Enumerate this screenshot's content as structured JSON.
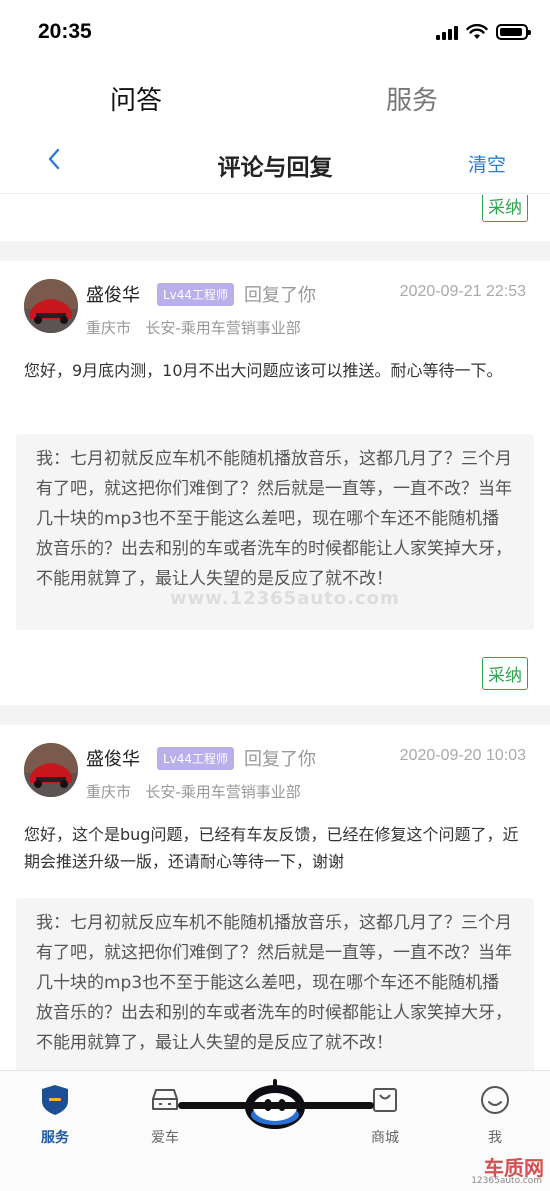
{
  "status_bar": {
    "time": "20:35",
    "battery_level": 0.9
  },
  "top_tabs": [
    {
      "label": "问答",
      "active": true
    },
    {
      "label": "服务",
      "active": false
    }
  ],
  "nav": {
    "title": "评论与回复",
    "clear_label": "清空",
    "back_icon": "chevron-left-icon"
  },
  "feed": {
    "partial_adopt_label": "采纳",
    "items": [
      {
        "username": "盛俊华",
        "level": "Lv44工程师",
        "action": "回复了你",
        "timestamp": "2020-09-21 22:53",
        "city": "重庆市",
        "org": "长安-乘用车营销事业部",
        "reply": "您好，9月底内测，10月不出大问题应该可以推送。耐心等待一下。",
        "quote": "我：七月初就反应车机不能随机播放音乐，这都几月了？三个月有了吧，就这把你们难倒了？然后就是一直等，一直不改？当年几十块的mp3也不至于能这么差吧，现在哪个车还不能随机播放音乐的？出去和别的车或者洗车的时候都能让人家笑掉大牙，不能用就算了，最让人失望的是反应了就不改！",
        "adopt_label": "采纳"
      },
      {
        "username": "盛俊华",
        "level": "Lv44工程师",
        "action": "回复了你",
        "timestamp": "2020-09-20 10:03",
        "city": "重庆市",
        "org": "长安-乘用车营销事业部",
        "reply": "您好，这个是bug问题，已经有车友反馈，已经在修复这个问题了，近期会推送升级一版，还请耐心等待一下，谢谢",
        "quote": "我：七月初就反应车机不能随机播放音乐，这都几月了？三个月有了吧，就这把你们难倒了？然后就是一直等，一直不改？当年几十块的mp3也不至于能这么差吧，现在哪个车还不能随机播放音乐的？出去和别的车或者洗车的时候都能让人家笑掉大牙，不能用就算了，最让人失望的是反应了就不改！"
      }
    ]
  },
  "watermark": {
    "middle": "www.12365auto.com",
    "logo": "车质网",
    "logo_sub": "12365auto.com"
  },
  "bottom_tabs": [
    {
      "label": "服务",
      "icon": "service-icon",
      "active": true
    },
    {
      "label": "爱车",
      "icon": "car-icon",
      "active": false
    },
    {
      "label": "",
      "icon": "robot-assistant-icon",
      "active": false
    },
    {
      "label": "商城",
      "icon": "shopping-bag-icon",
      "active": false
    },
    {
      "label": "我",
      "icon": "smiley-profile-icon",
      "active": false
    }
  ],
  "colors": {
    "accent_blue": "#2a7bd8",
    "adopt_green": "#2ea44f",
    "badge_purple": "#b8b0ec",
    "active_tab": "#1d5aa8"
  }
}
